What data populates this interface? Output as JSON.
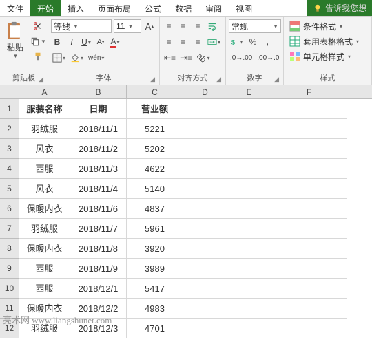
{
  "tabs": {
    "items": [
      "文件",
      "开始",
      "插入",
      "页面布局",
      "公式",
      "数据",
      "审阅",
      "视图"
    ],
    "active": 1,
    "tell": "告诉我您想"
  },
  "ribbon": {
    "clipboard": {
      "title": "剪贴板",
      "paste": "粘贴"
    },
    "font": {
      "title": "字体",
      "name": "等线",
      "size": "11"
    },
    "align": {
      "title": "对齐方式"
    },
    "number": {
      "title": "数字",
      "format": "常规"
    },
    "styles": {
      "title": "样式",
      "cond": "条件格式",
      "table": "套用表格格式",
      "cell": "单元格样式"
    }
  },
  "columns": [
    "A",
    "B",
    "C",
    "D",
    "E",
    "F"
  ],
  "headers": {
    "a": "服装名称",
    "b": "日期",
    "c": "营业额"
  },
  "rows": [
    {
      "a": "羽绒服",
      "b": "2018/11/1",
      "c": "5221"
    },
    {
      "a": "风衣",
      "b": "2018/11/2",
      "c": "5202"
    },
    {
      "a": "西服",
      "b": "2018/11/3",
      "c": "4622"
    },
    {
      "a": "风衣",
      "b": "2018/11/4",
      "c": "5140"
    },
    {
      "a": "保暖内衣",
      "b": "2018/11/6",
      "c": "4837"
    },
    {
      "a": "羽绒服",
      "b": "2018/11/7",
      "c": "5961"
    },
    {
      "a": "保暖内衣",
      "b": "2018/11/8",
      "c": "3920"
    },
    {
      "a": "西服",
      "b": "2018/11/9",
      "c": "3989"
    },
    {
      "a": "西服",
      "b": "2018/12/1",
      "c": "5417"
    },
    {
      "a": "保暖内衣",
      "b": "2018/12/2",
      "c": "4983"
    },
    {
      "a": "羽绒服",
      "b": "2018/12/3",
      "c": "4701"
    }
  ],
  "watermark": "亮术网 www.liangshunet.com"
}
